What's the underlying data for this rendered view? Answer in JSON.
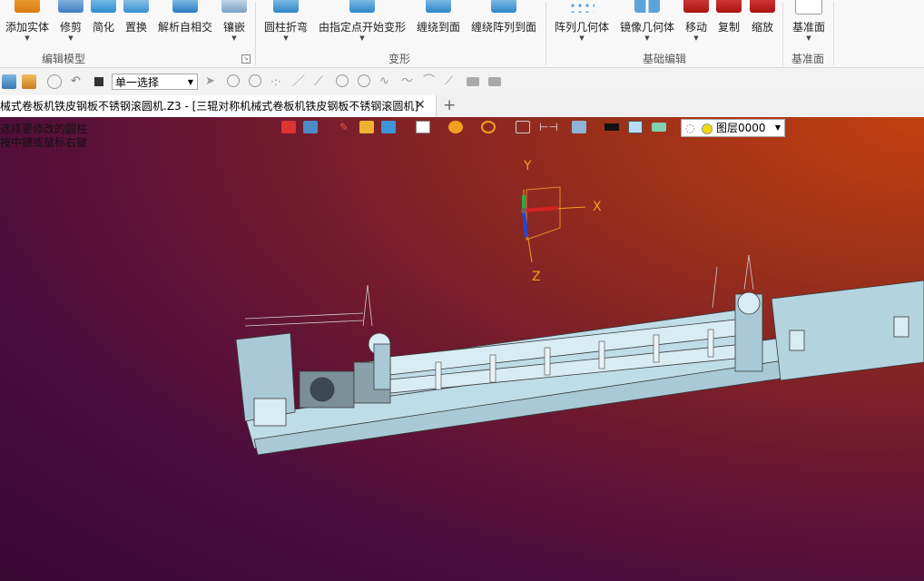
{
  "ribbon": {
    "groups": [
      {
        "label": "编辑模型",
        "buttons": [
          "添加实体",
          "修剪",
          "简化",
          "置换",
          "解析自相交",
          "镶嵌"
        ]
      },
      {
        "label": "变形",
        "buttons": [
          "圆柱折弯",
          "由指定点开始变形",
          "缠绕到面",
          "缠绕阵列到面"
        ]
      },
      {
        "label": "基础编辑",
        "buttons": [
          "阵列几何体",
          "镜像几何体",
          "移动",
          "复制",
          "缩放"
        ]
      },
      {
        "label": "基准面",
        "buttons": [
          "基准面"
        ]
      }
    ]
  },
  "toolbar": {
    "select_mode": "单一选择"
  },
  "tab": {
    "title": "械式卷板机铁皮钢板不锈钢滚圆机.Z3 - [三辊对称机械式卷板机铁皮钢板不锈钢滚圆机]"
  },
  "viewport": {
    "messages": [
      "选择要修改的圆柱",
      "按中键或鼠标右键"
    ],
    "layer": "图层0000",
    "axes": {
      "x": "X",
      "y": "Y",
      "z": "Z"
    }
  }
}
